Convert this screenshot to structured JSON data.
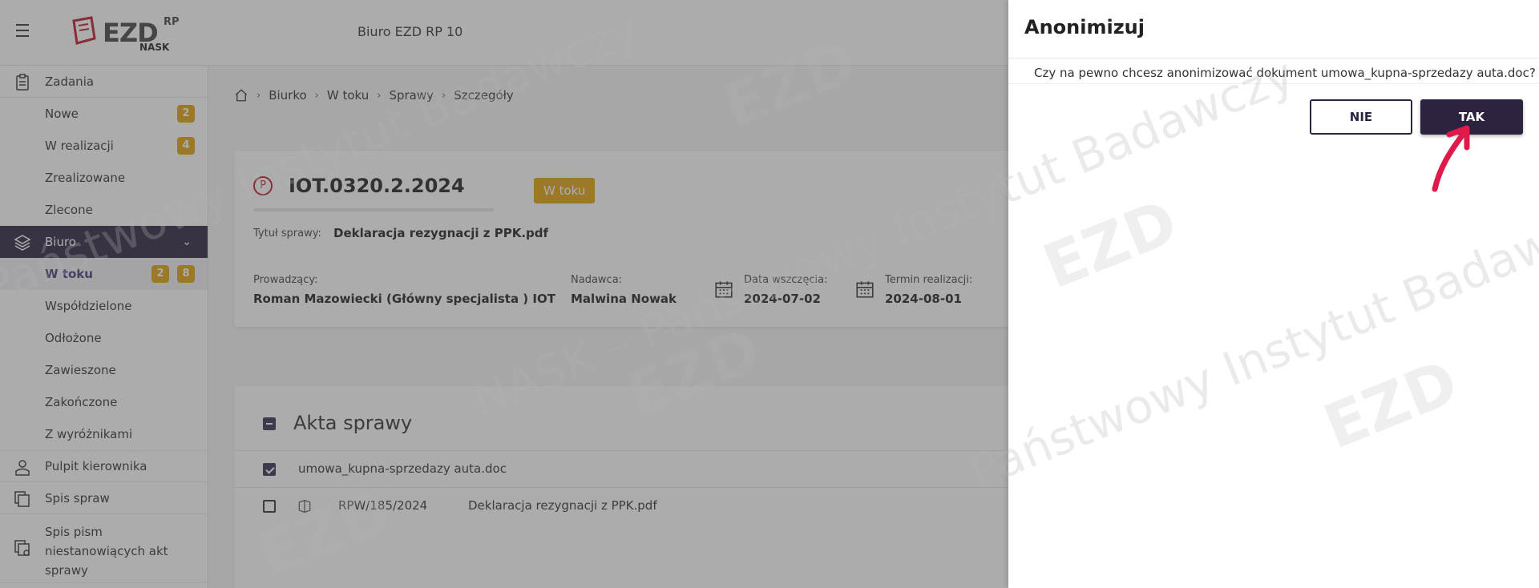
{
  "header": {
    "logo_ezd": "EZD",
    "logo_rp": "RP",
    "logo_nask": "NASK",
    "office_title": "Biuro EZD RP 10"
  },
  "sidebar": {
    "tasks": {
      "label": "Zadania",
      "items": [
        {
          "label": "Nowe",
          "badges": [
            "2"
          ]
        },
        {
          "label": "W realizacji",
          "badges": [
            "4"
          ]
        },
        {
          "label": "Zrealizowane",
          "badges": []
        },
        {
          "label": "Zlecone",
          "badges": []
        }
      ]
    },
    "office": {
      "label": "Biuro",
      "items": [
        {
          "label": "W toku",
          "badges": [
            "2",
            "8"
          ]
        },
        {
          "label": "Współdzielone",
          "badges": []
        },
        {
          "label": "Odłożone",
          "badges": []
        },
        {
          "label": "Zawieszone",
          "badges": []
        },
        {
          "label": "Zakończone",
          "badges": []
        },
        {
          "label": "Z wyróżnikami",
          "badges": []
        }
      ]
    },
    "manager_desk": "Pulpit kierownika",
    "case_list": "Spis spraw",
    "letters_list": "Spis pism niestanowiących akt sprawy"
  },
  "breadcrumb": [
    "Biurko",
    "W toku",
    "Sprawy",
    "Szczegóły"
  ],
  "case": {
    "priority_letter": "P",
    "number": "IOT.0320.2.2024",
    "status": "W toku",
    "title_label": "Tytuł sprawy:",
    "title_value": "Deklaracja rezygnacji z PPK.pdf",
    "owner_label": "Prowadzący:",
    "owner_value": "Roman Mazowiecki (Główny specjalista ) IOT",
    "sender_label": "Nadawca:",
    "sender_value": "Malwina Nowak",
    "start_label": "Data wszczęcia:",
    "start_value": "2024-07-02",
    "due_label": "Termin realizacji:",
    "due_value": "2024-08-01"
  },
  "files": {
    "title": "Akta sprawy",
    "rows": [
      {
        "name": "umowa_kupna-sprzedazy auta.doc",
        "checked": true
      },
      {
        "ref": "RPW/185/2024",
        "name": "Deklaracja rezygnacji z PPK.pdf",
        "checked": false
      }
    ]
  },
  "dialog": {
    "title": "Anonimizuj",
    "message": "Czy na pewno chcesz anonimizować dokument umowa_kupna-sprzedazy auta.doc?",
    "no_label": "NIE",
    "yes_label": "TAK"
  },
  "watermark": {
    "lines": [
      "Państwowy Instytut Badawczy",
      "NASK – Państwowy Instytut Badawczy"
    ]
  },
  "colors": {
    "primary": "#2d2341",
    "badge": "#e0a310",
    "priority": "#c0182d",
    "arrow": "#e0194a"
  }
}
